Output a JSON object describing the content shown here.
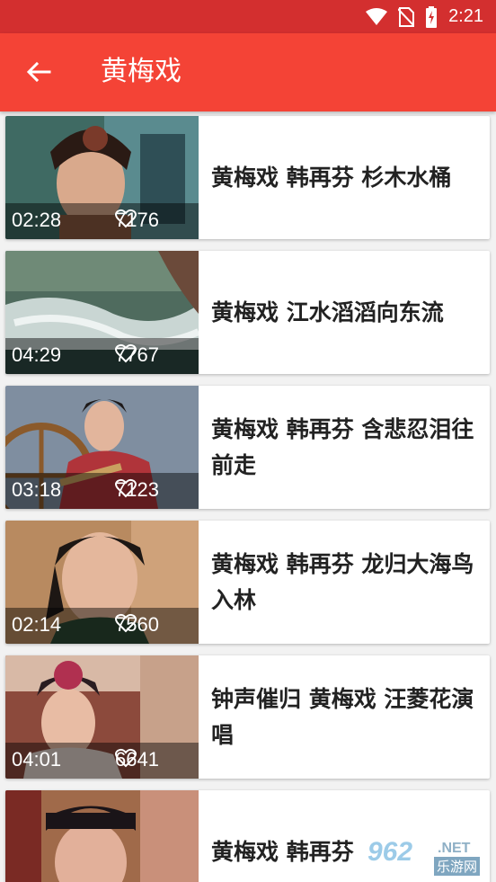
{
  "status_bar": {
    "time": "2:21",
    "icons": [
      "wifi-icon",
      "no-sim-icon",
      "battery-charging-icon"
    ]
  },
  "app_bar": {
    "back_icon": "arrow-left-icon",
    "title": "黄梅戏"
  },
  "videos": [
    {
      "title": "黄梅戏  韩再芬 杉木水桶",
      "duration": "02:28",
      "likes": "7176"
    },
    {
      "title": "黄梅戏 江水滔滔向东流",
      "duration": "04:29",
      "likes": "7767"
    },
    {
      "title": "黄梅戏  韩再芬 含悲忍泪往前走",
      "duration": "03:18",
      "likes": "7123"
    },
    {
      "title": "黄梅戏  韩再芬 龙归大海鸟入林",
      "duration": "02:14",
      "likes": "7560"
    },
    {
      "title": "钟声催归 黄梅戏 汪菱花演唱",
      "duration": "04:01",
      "likes": "6641"
    },
    {
      "title": "黄梅戏 韩再芬",
      "duration": "",
      "likes": ""
    }
  ],
  "colors": {
    "status_bar": "#d32f2f",
    "app_bar": "#f44336",
    "background": "#f2f2f2"
  },
  "watermark": {
    "number": "962",
    "suffix": ".NET",
    "sub": "乐游网"
  }
}
